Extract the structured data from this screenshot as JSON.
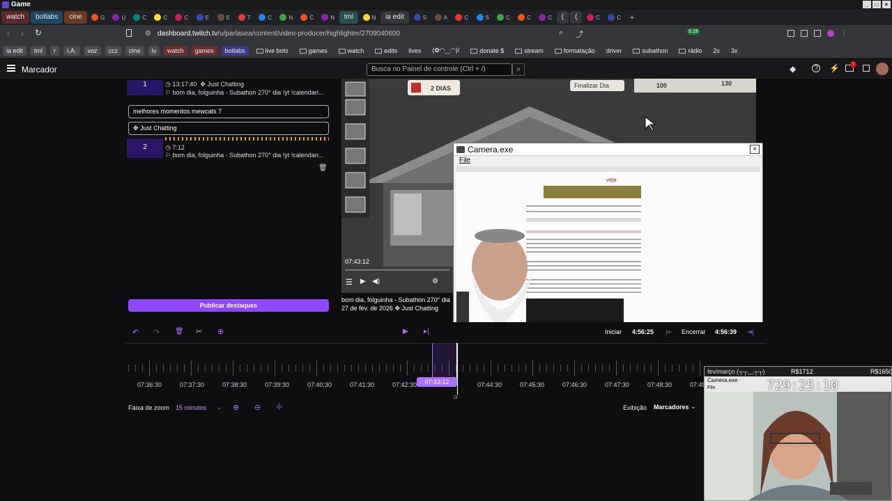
{
  "os": {
    "title": "Game"
  },
  "tabs": [
    {
      "label": "watch",
      "style": "red"
    },
    {
      "label": "botlabs",
      "style": "blue"
    },
    {
      "label": "cine",
      "style": "brown"
    },
    {
      "label": "G"
    },
    {
      "label": "U"
    },
    {
      "label": "C"
    },
    {
      "label": "C"
    },
    {
      "label": "C"
    },
    {
      "label": "E"
    },
    {
      "label": "E"
    },
    {
      "label": "T"
    },
    {
      "label": "C"
    },
    {
      "label": "N"
    },
    {
      "label": "C"
    },
    {
      "label": "N"
    },
    {
      "label": "tml",
      "style": "teal"
    },
    {
      "label": "N"
    },
    {
      "label": "ia edit",
      "style": "dark"
    },
    {
      "label": "S"
    },
    {
      "label": "A"
    },
    {
      "label": "C"
    },
    {
      "label": "S"
    },
    {
      "label": "C"
    },
    {
      "label": "C"
    },
    {
      "label": "C"
    },
    {
      "label": "(",
      "style": "dark"
    },
    {
      "label": "(",
      "style": "dark"
    },
    {
      "label": "C"
    },
    {
      "label": "C"
    }
  ],
  "address": {
    "url_host": "dashboard.twitch.tv",
    "url_path": "/u/parlasea/content/video-producer/highlighter/2709040600",
    "ext_badge": "5.19"
  },
  "bookmarks": [
    {
      "label": "ia edit",
      "style": "pill"
    },
    {
      "label": "tml",
      "style": "pill"
    },
    {
      "label": "r",
      "style": "pill"
    },
    {
      "label": "I.A.",
      "style": "pill"
    },
    {
      "label": "voz",
      "style": "pill"
    },
    {
      "label": "ccz",
      "style": "pill"
    },
    {
      "label": "cine",
      "style": "pill"
    },
    {
      "label": "lv",
      "style": "pill"
    },
    {
      "label": "watch",
      "style": "red"
    },
    {
      "label": "games",
      "style": "red"
    },
    {
      "label": "botlabs",
      "style": "purple"
    },
    {
      "label": "live bots",
      "folder": true
    },
    {
      "label": "games",
      "folder": true
    },
    {
      "label": "watch",
      "folder": true
    },
    {
      "label": "edits",
      "folder": true
    },
    {
      "label": "lives"
    },
    {
      "label": "(✿◠‿◠)/"
    },
    {
      "label": "donate $",
      "folder": true
    },
    {
      "label": "stream",
      "folder": true
    },
    {
      "label": "formatação",
      "folder": true
    },
    {
      "label": "driver"
    },
    {
      "label": "subathon",
      "folder": true
    },
    {
      "label": "rádio",
      "folder": true
    },
    {
      "label": "2x"
    },
    {
      "label": "3x"
    }
  ],
  "header": {
    "title": "Marcador",
    "search_placeholder": "Busca no Painel de controle (Ctrl + /)",
    "notif_count": "1"
  },
  "highlights": [
    {
      "number": "1",
      "time": "13:17:40",
      "category": "Just Chatting",
      "title": "bom dia, folguinha - Subathon 270° dia !yt !calendari..."
    },
    {
      "number": "2",
      "time": "7:12",
      "title": "bom dia, folguinha - Subathon 270° dia !yt !calendari..."
    }
  ],
  "edit": {
    "title_value": "melhores momentos mewcats 7",
    "category_value": "Just Chatting"
  },
  "publish_label": "Publicar destaques",
  "player": {
    "current_time": "07:43:12",
    "stream_title": "bom dia, folguinha - Subathon 270° dia",
    "stream_date": "27 de fev. de 2026",
    "category": "Just Chatting"
  },
  "game_hud": {
    "days": "2 DIAS",
    "finish_day": "Finalizar Dia",
    "stat1": "100",
    "stat2": "130"
  },
  "camera_window": {
    "title": "Camera.exe",
    "menu": "File",
    "site": "veja"
  },
  "clip_range": {
    "start_label": "Iniciar",
    "start_value": "4:56:25",
    "end_label": "Encerrar",
    "end_value": "4:56:39"
  },
  "timeline": {
    "labels": [
      "07:36:30",
      "07:37:30",
      "07:38:30",
      "07:39:30",
      "07:40:30",
      "07:41:30",
      "07:42:30",
      "07:43:12",
      "07:44:30",
      "07:45:30",
      "07:46:30",
      "07:47:30",
      "07:48:30",
      "07:49:30"
    ],
    "zoom_label": "Faixa de zoom",
    "zoom_value": "15 minutos",
    "view_label": "Exibição",
    "view_value": "Marcadores"
  },
  "webcam": {
    "strip_label": "fev/março (┬┬﹏┬┬)",
    "amount1": "R$1712",
    "amount2": "R$1650",
    "window_title": "Camera.exe",
    "menu": "File",
    "timer": "729:25:10"
  }
}
